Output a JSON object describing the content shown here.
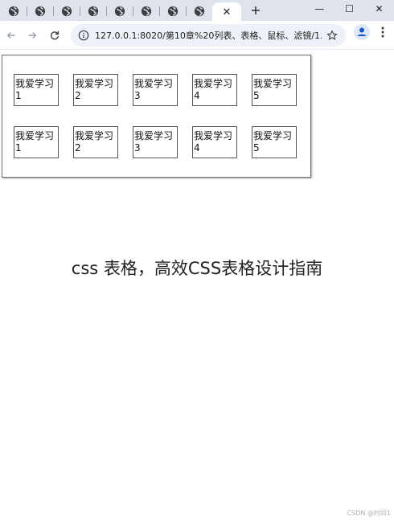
{
  "browser": {
    "tabs": [
      {
        "icon": "globe-icon"
      },
      {
        "icon": "globe-icon"
      },
      {
        "icon": "globe-icon"
      },
      {
        "icon": "globe-icon"
      },
      {
        "icon": "globe-icon"
      },
      {
        "icon": "globe-icon"
      },
      {
        "icon": "globe-icon"
      },
      {
        "icon": "globe-icon"
      }
    ],
    "active_tab_close": "✕",
    "new_tab": "+",
    "window_controls": {
      "minimize": "—",
      "maximize": "☐",
      "close": "✕"
    },
    "address": "127.0.0.1:8020/第10章%20列表、表格、鼠标、滤镜/1..."
  },
  "page": {
    "rows": [
      {
        "cells": [
          {
            "label": "我爱学习",
            "num": "1"
          },
          {
            "label": "我爱学习",
            "num": "2"
          },
          {
            "label": "我爱学习",
            "num": "3"
          },
          {
            "label": "我爱学习",
            "num": "4"
          },
          {
            "label": "我爱学习",
            "num": "5"
          }
        ]
      },
      {
        "cells": [
          {
            "label": "我爱学习",
            "num": "1"
          },
          {
            "label": "我爱学习",
            "num": "2"
          },
          {
            "label": "我爱学习",
            "num": "3"
          },
          {
            "label": "我爱学习",
            "num": "4"
          },
          {
            "label": "我爱学习",
            "num": "5"
          }
        ]
      }
    ],
    "caption": "css 表格，高效CSS表格设计指南",
    "watermark": "CSDN @时间1"
  },
  "colors": {
    "tabstrip_bg": "#dfe3eb",
    "omnibox_bg": "#eef1f7",
    "profile_accent": "#1a56c4"
  }
}
